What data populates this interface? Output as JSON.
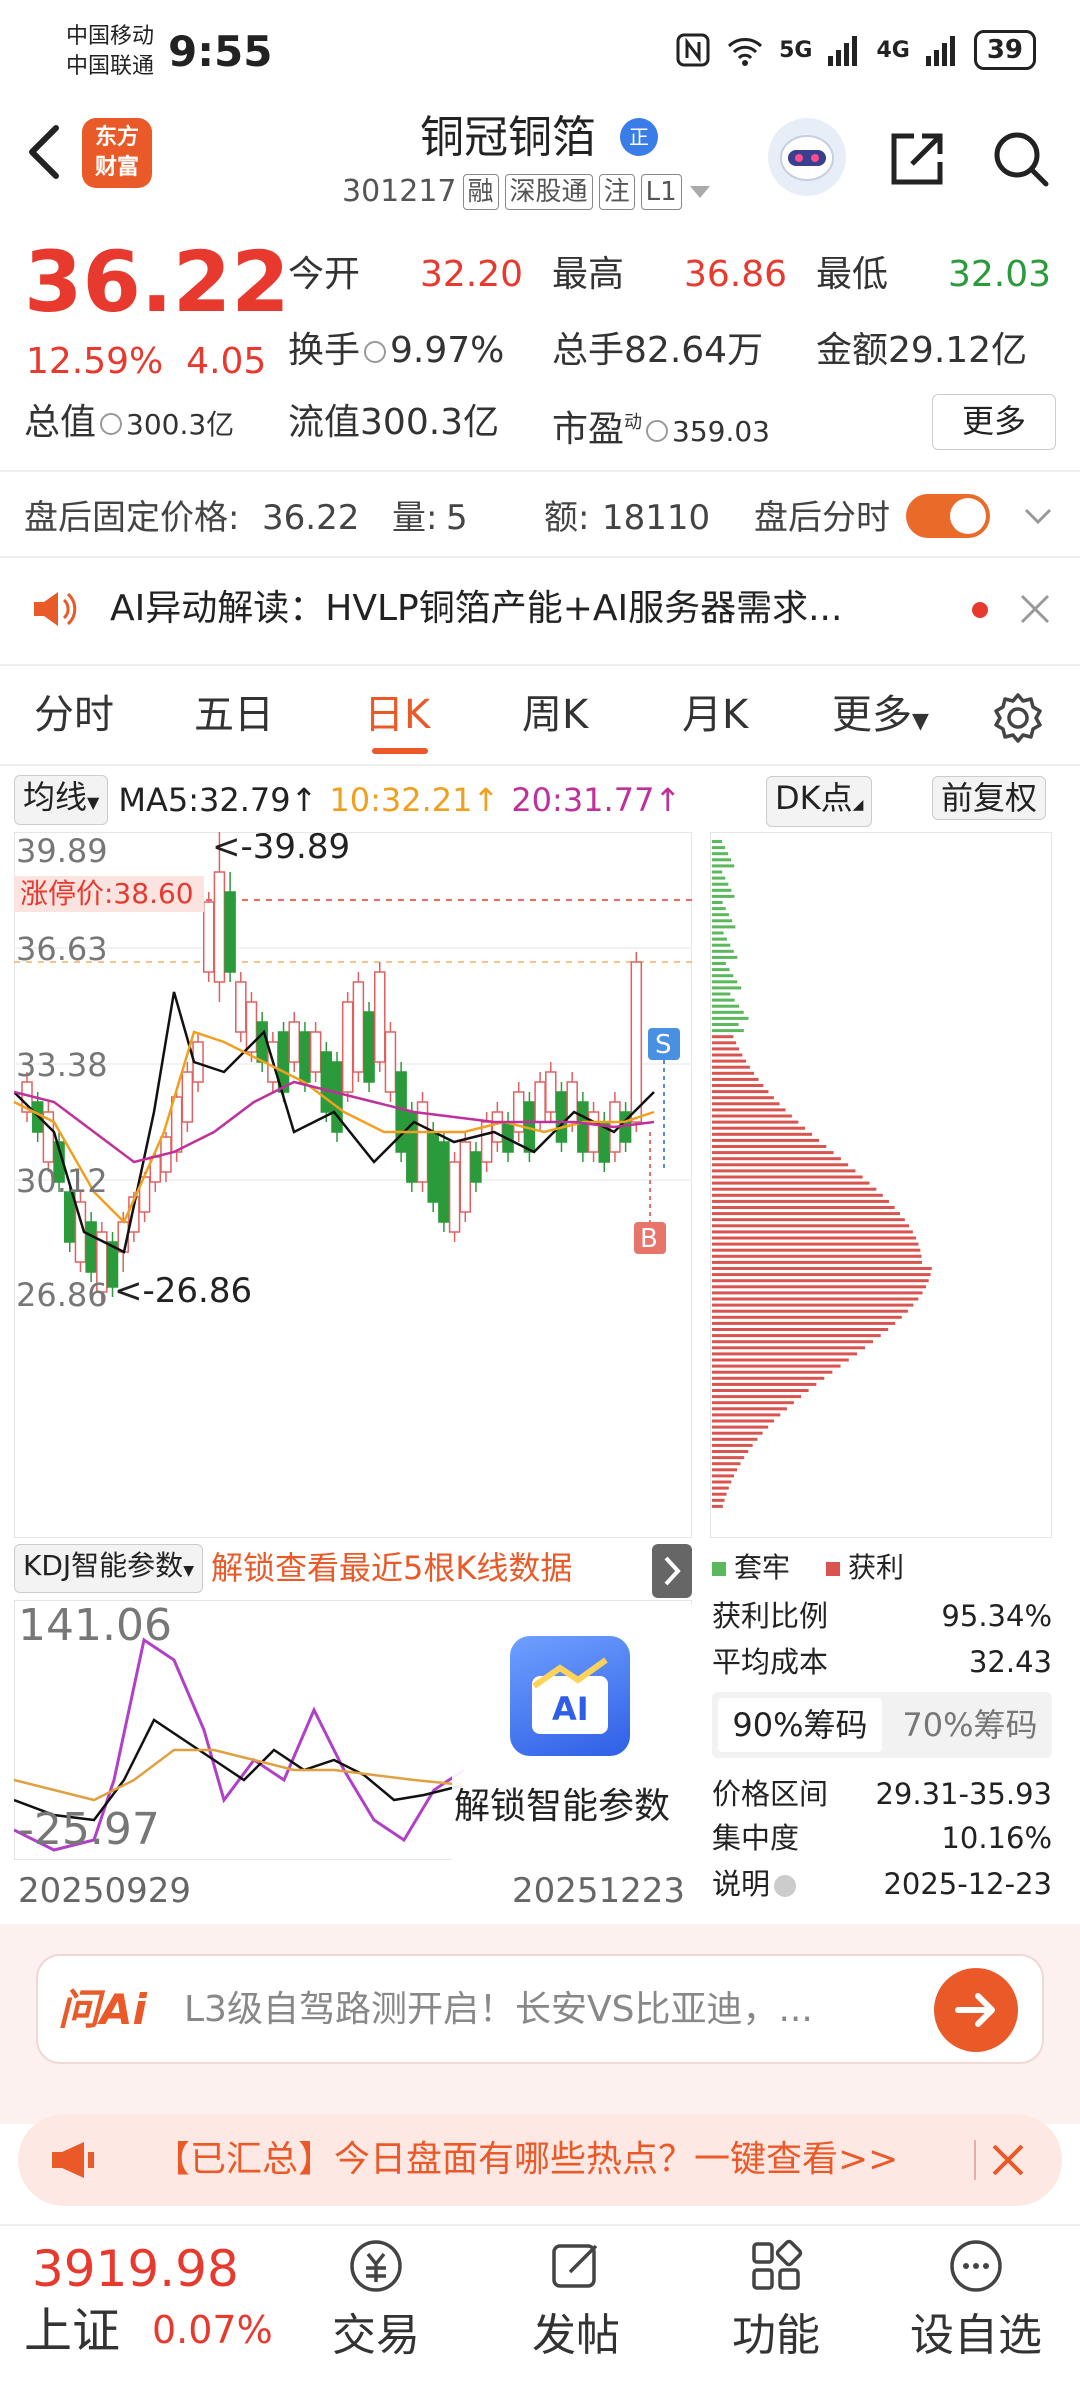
{
  "status": {
    "carrier1": "中国移动",
    "carrier2": "中国联通",
    "time": "9:55",
    "net1": "5G",
    "net2": "4G",
    "battery": "39"
  },
  "header": {
    "logo_line1": "东方",
    "logo_line2": "财富",
    "name": "铜冠铜箔",
    "badge": "正",
    "code": "301217",
    "tags": [
      "融",
      "深股通",
      "注",
      "L1"
    ]
  },
  "quote": {
    "price": "36.22",
    "pct": "12.59%",
    "change": "4.05",
    "open_label": "今开",
    "open": "32.20",
    "high_label": "最高",
    "high": "36.86",
    "low_label": "最低",
    "low": "32.03",
    "turnover_label": "换手",
    "turnover": "9.97%",
    "volume_label": "总手",
    "volume": "82.64万",
    "amount_label": "金额",
    "amount": "29.12亿",
    "mktcap_label": "总值",
    "mktcap": "300.3亿",
    "float_label": "流值",
    "float": "300.3亿",
    "pe_label": "市盈",
    "pe_sup": "动",
    "pe": "359.03",
    "more": "更多"
  },
  "afterhours": {
    "label": "盘后固定价格:",
    "price": "36.22",
    "vol_label": "量:",
    "vol": "5",
    "amt_label": "额:",
    "amt": "18110",
    "switch_label": "盘后分时"
  },
  "ai_banner": {
    "text": "AI异动解读：HVLP铜箔产能+AI服务器需求..."
  },
  "tabs": [
    "分时",
    "五日",
    "日K",
    "周K",
    "月K",
    "更多"
  ],
  "ma": {
    "btn": "均线",
    "ma5": "MA5:32.79↑",
    "ma10": "10:32.21↑",
    "ma20": "20:31.77↑",
    "ma5_color": "#222222",
    "ma10_color": "#f0a020",
    "ma20_color": "#c0309a",
    "dk": "DK点",
    "fq": "前复权"
  },
  "chart_labels": {
    "y1": "39.89",
    "y2": "36.63",
    "y3": "33.38",
    "y4": "30.12",
    "y5": "26.86",
    "limit": "涨停价:38.60",
    "max_mark": "<-39.89",
    "min_mark": "<-26.86",
    "s": "S",
    "b": "B"
  },
  "kdj": {
    "btn": "KDJ智能参数",
    "unlock": "解锁查看最近5根K线数据",
    "top": "141.06",
    "bottom": "-25.97",
    "ai_label": "AI",
    "ai_unlock": "解锁智能参数",
    "date_start": "20250929",
    "date_end": "20251223"
  },
  "chips": {
    "legend_trapped": "套牢",
    "legend_profit": "获利",
    "profit_ratio_label": "获利比例",
    "profit_ratio": "95.34%",
    "avg_cost_label": "平均成本",
    "avg_cost": "32.43",
    "tab90": "90%筹码",
    "tab70": "70%筹码",
    "range_label": "价格区间",
    "range": "29.31-35.93",
    "conc_label": "集中度",
    "conc": "10.16%",
    "note_label": "说明",
    "note": "2025-12-23",
    "trapped_color": "#5cb85c",
    "profit_color": "#d9534f"
  },
  "wen": {
    "logo": "问Ai",
    "text": "L3级自驾路测开启！长安VS比亚迪，..."
  },
  "notice": {
    "text": "【已汇总】今日盘面有哪些热点？一键查看>>"
  },
  "bottom": {
    "index_value": "3919.98",
    "index_name": "上证",
    "index_pct": "0.07%",
    "nav": [
      "交易",
      "发帖",
      "功能",
      "设自选"
    ]
  }
}
